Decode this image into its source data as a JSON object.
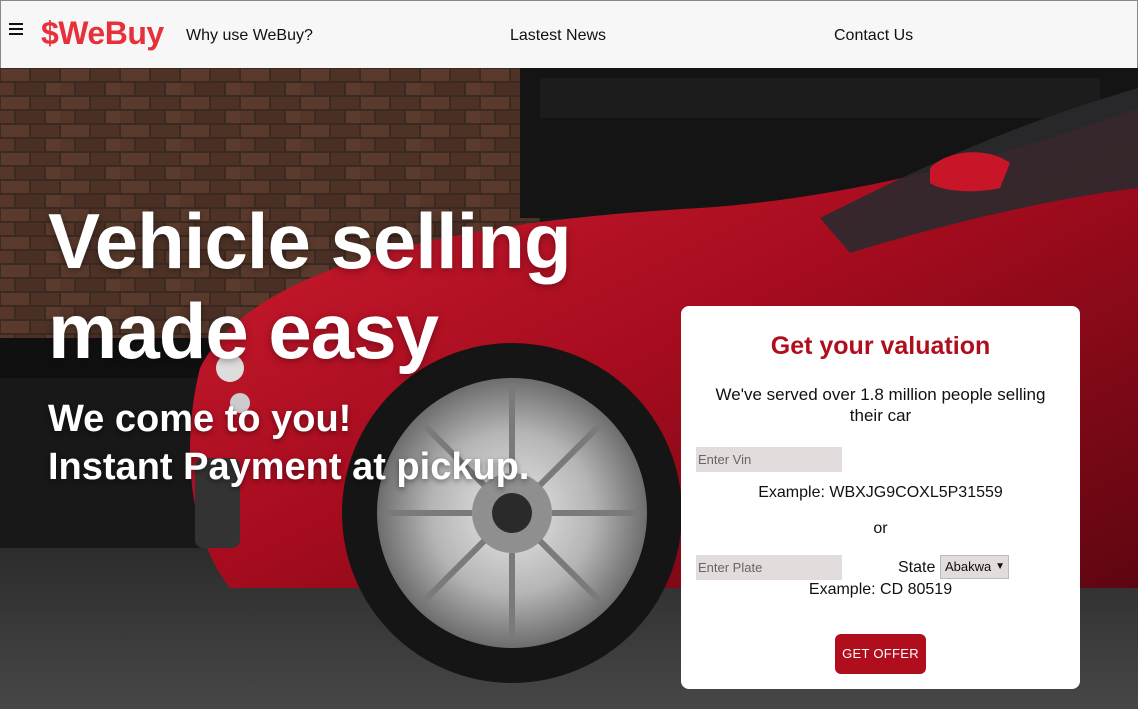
{
  "nav": {
    "logo": "$WeBuy",
    "links": [
      "Why use WeBuy?",
      "Lastest News",
      "Contact Us"
    ]
  },
  "hero": {
    "headline_line1": "Vehicle selling",
    "headline_line2": "made easy",
    "subline1": "We come to you!",
    "subline2": "Instant Payment at pickup."
  },
  "valuation": {
    "title": "Get your valuation",
    "description": "We've served over 1.8 million people selling their car",
    "vin_placeholder": "Enter Vin",
    "vin_example": "Example: WBXJG9COXL5P31559",
    "or_text": "or",
    "plate_placeholder": "Enter Plate",
    "state_label": "State",
    "state_selected": "Abakwa",
    "plate_example": "Example: CD 80519",
    "button_label": "GET OFFER"
  },
  "colors": {
    "brand_red": "#e8303a",
    "button_red": "#b10e1d",
    "input_bg": "#e2dcdc"
  }
}
